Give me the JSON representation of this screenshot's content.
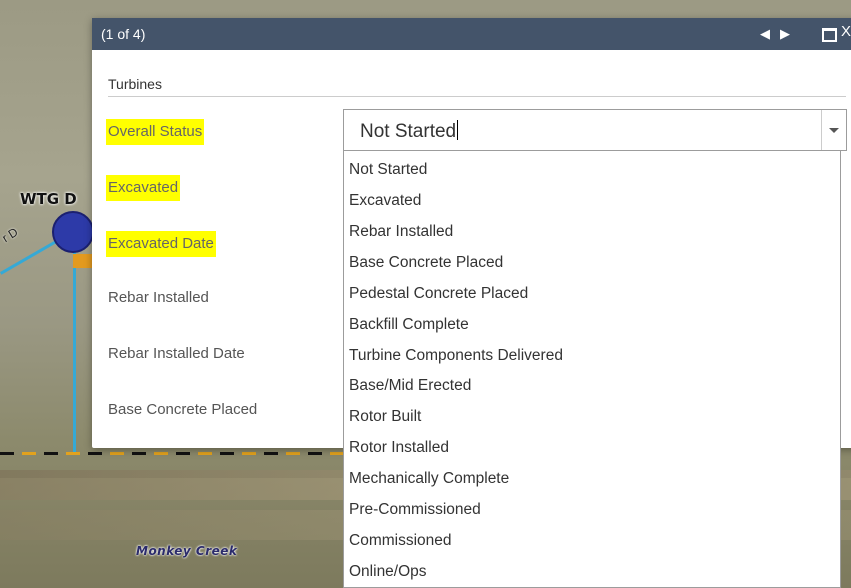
{
  "map": {
    "turbine_label": "WTG D",
    "road_label": "r D",
    "creek_label": "Monkey Creek"
  },
  "popup": {
    "count": "(1 of 4)",
    "prev_icon": "triangle-left",
    "next_icon": "triangle-right",
    "maximize_icon": "maximize-box",
    "close_label": "X",
    "section_title": "Turbines",
    "fields": [
      {
        "label": "Overall Status",
        "highlighted": true
      },
      {
        "label": "Excavated",
        "highlighted": true
      },
      {
        "label": "Excavated Date",
        "highlighted": true
      },
      {
        "label": "Rebar Installed",
        "highlighted": false
      },
      {
        "label": "Rebar Installed Date",
        "highlighted": false
      },
      {
        "label": "Base Concrete Placed",
        "highlighted": false
      }
    ],
    "status_select": {
      "value": "Not Started",
      "options": [
        "Not Started",
        "Excavated",
        "Rebar Installed",
        "Base Concrete Placed",
        "Pedestal Concrete Placed",
        "Backfill Complete",
        "Turbine Components Delivered",
        "Base/Mid Erected",
        "Rotor Built",
        "Rotor Installed",
        "Mechanically Complete",
        "Pre-Commissioned",
        "Commissioned",
        "Online/Ops"
      ]
    }
  },
  "colors": {
    "header_bg": "#44546a",
    "highlight": "#ffff00",
    "line_blue": "#35a9d6",
    "turbine_dot": "#2d3aa8"
  }
}
